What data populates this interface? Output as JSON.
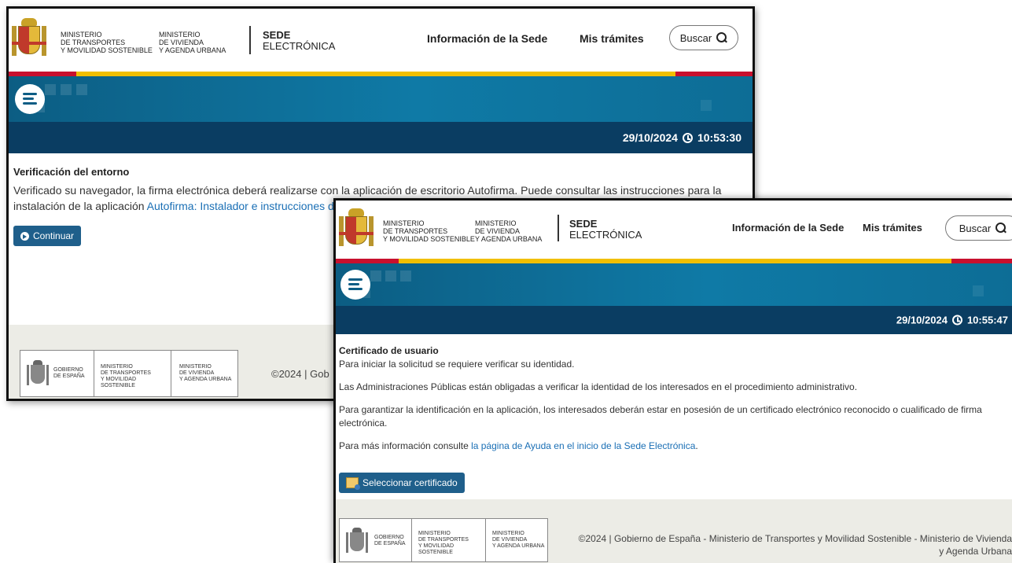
{
  "header": {
    "ministry1": "MINISTERIO\nDE TRANSPORTES\nY MOVILIDAD SOSTENIBLE",
    "ministry2": "MINISTERIO\nDE VIVIENDA\nY AGENDA URBANA",
    "sede_title": "SEDE",
    "sede_sub": "ELECTRÓNICA",
    "nav_info": "Información de la Sede",
    "nav_tramites": "Mis trámites",
    "search_label": "Buscar"
  },
  "shot1": {
    "datetime": "29/10/2024",
    "time": "10:53:30",
    "heading": "Verificación del entorno",
    "text": "Verificado su navegador, la firma electrónica deberá realizarse con la aplicación de escritorio Autofirma. Puede consultar las instrucciones para la instalación de la aplicación ",
    "link": "Autofirma: Instalador e instrucciones de instalación.",
    "button": "Continuar",
    "copyright": "©2024 | Gob"
  },
  "shot2": {
    "datetime": "29/10/2024",
    "time": "10:55:47",
    "heading": "Certificado de usuario",
    "p1": "Para iniciar la solicitud se requiere verificar su identidad.",
    "p2": "Las Administraciones Públicas están obligadas a verificar la identidad de los interesados en el procedimiento administrativo.",
    "p3": "Para garantizar la identificación en la aplicación, los interesados deberán estar en posesión de un certificado electrónico reconocido o cualificado de firma electrónica.",
    "p4_prefix": "Para más información consulte ",
    "p4_link": "la página de Ayuda en el inicio de la Sede Electrónica",
    "p4_suffix": ".",
    "button": "Seleccionar certificado",
    "copyright": "©2024 | Gobierno de España - Ministerio de Transportes y Movilidad Sostenible - Ministerio de Vivienda y Agenda Urbana"
  },
  "footer": {
    "gobierno": "GOBIERNO\nDE ESPAÑA",
    "ministry1": "MINISTERIO\nDE TRANSPORTES\nY MOVILIDAD SOSTENIBLE",
    "ministry2": "MINISTERIO\nDE VIVIENDA\nY AGENDA URBANA"
  },
  "colors": {
    "banner_blue": "#0f7aa6",
    "datebar_navy": "#0a3d62",
    "flag_red": "#c8102e",
    "flag_yellow": "#f1bf00",
    "link_blue": "#1a6fb5",
    "button_blue": "#1f5f8b",
    "footer_bg": "#ecece6"
  }
}
